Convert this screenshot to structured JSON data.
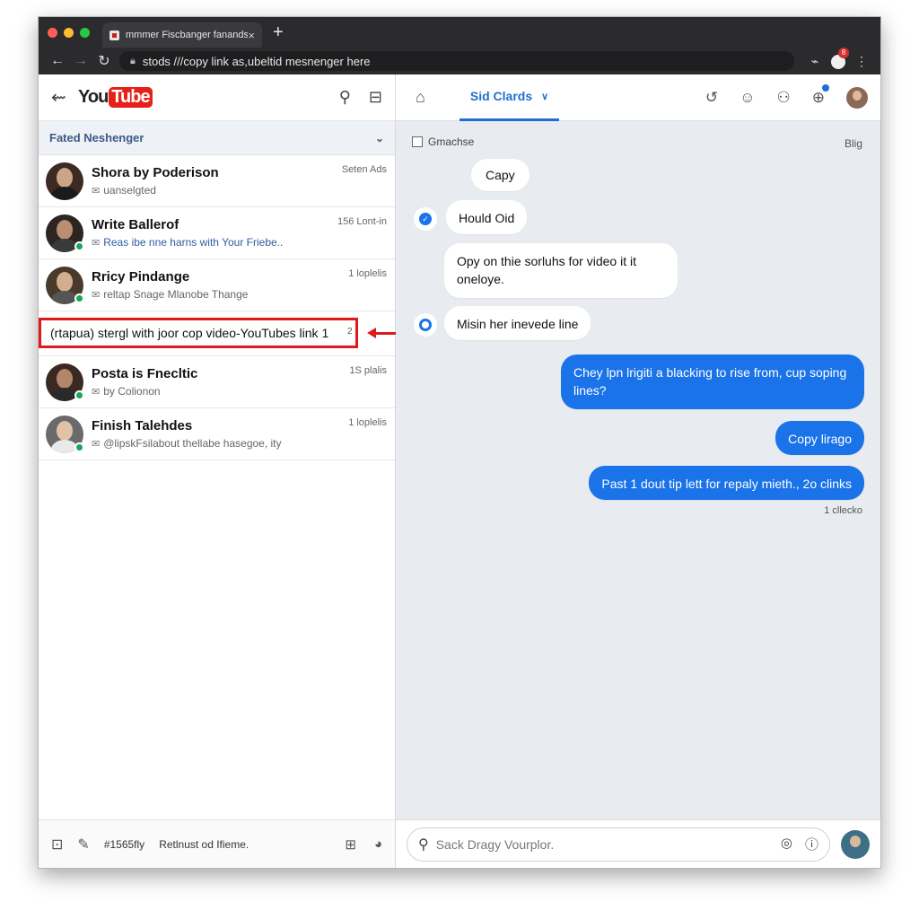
{
  "browser": {
    "tab_title": "mmmer Fiscbanger fanands",
    "tab_close": "×",
    "new_tab": "+",
    "address": "stods ///copy link as,ubeltid mesnenger here",
    "notification_badge": "8"
  },
  "left_panel": {
    "section_title": "Fated Neshenger",
    "conversations": [
      {
        "name": "Shora by Poderison",
        "sub": "uanselgted",
        "time": "Seten Ads",
        "sub_blue": false
      },
      {
        "name": "Write Ballerof",
        "sub": "Reas ibe nne harns with Your Friebe..",
        "time": "156 Lont-in",
        "sub_blue": true
      },
      {
        "name": "Rricy Pindange",
        "sub": "reltap Snage Mlanobe Thange",
        "time": "1 loplelis",
        "sub_blue": false
      },
      {
        "name": "Posta is Fnecltic",
        "sub": "by Colionon",
        "time": "1S plalis",
        "sub_blue": false
      },
      {
        "name": "Finish Talehdes",
        "sub": "@lipskFsilabout thellabe hasegoe, ity",
        "time": "1 loplelis",
        "sub_blue": false
      }
    ],
    "highlight_text": "(rtapua) stergl with joor cop video-YouTubes link  1",
    "highlight_extra": "2",
    "footer": {
      "count": "#1565fly",
      "label": "Retlnust od Ifieme."
    }
  },
  "right_panel": {
    "tab_label": "Sid Clards",
    "meta_left": "Gmachse",
    "meta_right": "Blig",
    "messages": [
      {
        "text": "Capy"
      },
      {
        "text": "Hould Oid"
      },
      {
        "text": "Opy on thie sorluhs for video it it oneloye."
      },
      {
        "text": "Misin her inevede line"
      },
      {
        "text": "Chey lpn lrigiti a blacking to rise from, cup soping lines?"
      },
      {
        "text": "Copy lirago"
      },
      {
        "text": "Past 1 dout tip lett for repaly mieth., 2o clinks"
      }
    ],
    "seen": "1 cllecko",
    "search_placeholder": "Sack Dragy Vourplor."
  },
  "colors": {
    "accent": "#1a73e8",
    "highlight": "#e01a1a",
    "youtube": "#e62117"
  }
}
